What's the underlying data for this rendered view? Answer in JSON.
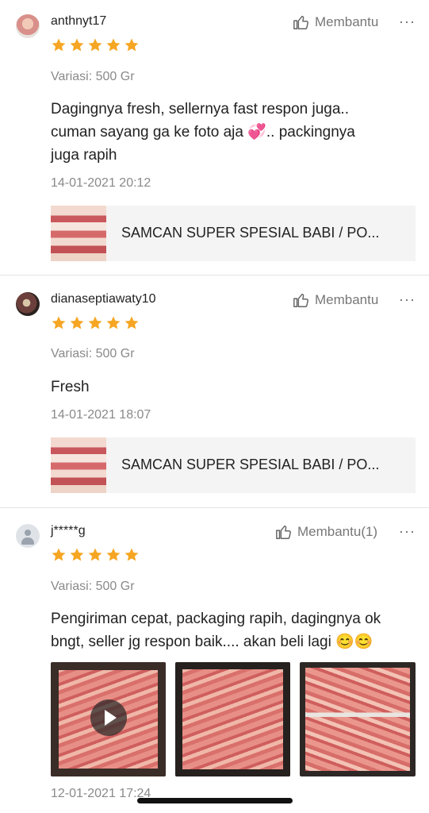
{
  "reviews": [
    {
      "username": "anthnyt17",
      "helpful_label": "Membantu",
      "more_label": "···",
      "rating": 5,
      "variant": "Variasi: 500 Gr",
      "text_lines": [
        "Dagingnya fresh, sellernya fast respon juga..",
        "cuman sayang ga ke foto aja 💞.. packingnya",
        "juga rapih"
      ],
      "date": "14-01-2021 20:12",
      "product_title": "SAMCAN SUPER SPESIAL BABI / PO..."
    },
    {
      "username": "dianaseptiawaty10",
      "helpful_label": "Membantu",
      "more_label": "···",
      "rating": 5,
      "variant": "Variasi: 500 Gr",
      "text_lines": [
        "Fresh"
      ],
      "date": "14-01-2021 18:07",
      "product_title": "SAMCAN SUPER SPESIAL BABI / PO..."
    },
    {
      "username": "j*****g",
      "helpful_label": "Membantu(1)",
      "more_label": "···",
      "rating": 5,
      "variant": "Variasi: 500 Gr",
      "text_lines": [
        "Pengiriman cepat, packaging rapih, dagingnya ok",
        "bngt, seller jg respon baik.... akan beli lagi 😊😊"
      ],
      "date": "12-01-2021 17:24"
    }
  ],
  "colors": {
    "star": "#f6a623",
    "muted_text": "#8a8a8a",
    "divider": "#e4e4e4"
  },
  "icons": [
    "thumbs-up-icon",
    "star-icon",
    "more-options-icon",
    "play-icon",
    "default-avatar-icon"
  ]
}
